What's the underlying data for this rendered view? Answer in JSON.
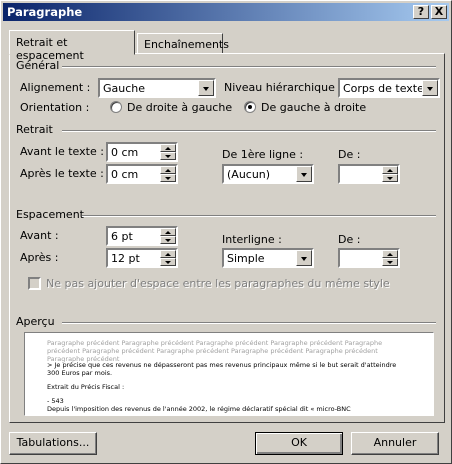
{
  "window": {
    "title": "Paragraphe",
    "help_label": "?",
    "close_label": "X"
  },
  "tabs": [
    {
      "label": "Retrait et espacement",
      "active": true
    },
    {
      "label": "Enchaînements",
      "active": false
    }
  ],
  "general": {
    "group_label": "Général",
    "alignment_label": "Alignement :",
    "alignment_value": "Gauche",
    "level_label": "Niveau hiérarchique :",
    "level_value": "Corps de texte",
    "orientation_label": "Orientation :",
    "orientation_options": [
      {
        "label": "De droite à gauche",
        "selected": false
      },
      {
        "label": "De gauche à droite",
        "selected": true
      }
    ]
  },
  "indent": {
    "group_label": "Retrait",
    "before_label": "Avant le texte :",
    "before_value": "0 cm",
    "after_label": "Après le texte :",
    "after_value": "0 cm",
    "first_line_label": "De 1ère ligne :",
    "first_line_value": "(Aucun)",
    "by_label": "De :",
    "by_value": ""
  },
  "spacing": {
    "group_label": "Espacement",
    "before_label": "Avant :",
    "before_value": "6 pt",
    "after_label": "Après :",
    "after_value": "12 pt",
    "line_label": "Interligne :",
    "line_value": "Simple",
    "at_label": "De :",
    "at_value": "",
    "no_space_label": "Ne pas ajouter d'espace entre les paragraphes du même style",
    "no_space_checked": false
  },
  "preview": {
    "group_label": "Aperçu",
    "previous_text": "Paragraphe précédent Paragraphe précédent Paragraphe précédent Paragraphe précédent Paragraphe précédent Paragraphe précédent Paragraphe précédent Paragraphe précédent Paragraphe précédent Paragraphe précédent",
    "line1": "> Je précise que ces revenus ne dépasseront pas mes revenus principaux même si le but serait d'atteindre 300 Euros par mois.",
    "line2": "Extrait du Précis Fiscal :",
    "line3": "- 543",
    "line4": "Depuis l'imposition des revenus de l'année 2002, le régime déclaratif spécial dit « micro-BNC"
  },
  "buttons": {
    "tabs_label": "Tabulations...",
    "ok_label": "OK",
    "cancel_label": "Annuler"
  }
}
